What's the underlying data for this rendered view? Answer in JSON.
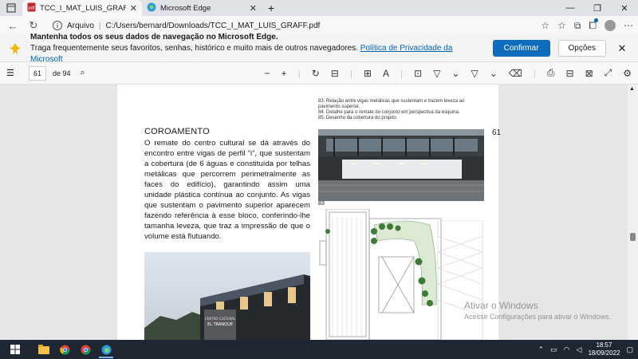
{
  "tabs": [
    {
      "title": "TCC_I_MAT_LUIS_GRAFF.pdf",
      "icon": "pdf-icon",
      "active": true
    },
    {
      "title": "Microsoft Edge",
      "icon": "edge-icon",
      "active": false
    }
  ],
  "window": {
    "minimize": "—",
    "maximize": "❐",
    "close": "✕"
  },
  "address": {
    "protocol_label": "Arquivo",
    "url": "C:/Users/bernard/Downloads/TCC_I_MAT_LUIS_GRAFF.pdf"
  },
  "notification": {
    "line1": "Mantenha todos os seus dados de navegação no Microsoft Edge.",
    "line2": "Traga frequentemente seus favoritos, senhas, histórico e muito mais de outros navegadores.",
    "link": "Política de Privacidade da Microsoft",
    "confirm": "Confirmar",
    "options": "Opções"
  },
  "pdf_toolbar": {
    "page": "61",
    "of_label": "de 94"
  },
  "page": {
    "captions": [
      "83. Relação entre vigas metálicas que sustentam e trazem leveza ao",
      "pavimento superior.",
      "84. Detalhe para o remate do conjunto em perspectiva da esquina.",
      "85. Desenho da cobertura do projeto."
    ],
    "heading": "COROAMENTO",
    "page_number": "61",
    "body": "O remate do centro cultural se dá através do encontro entre vigas de perfil “i”, que sustentam a cobertura (de 6 águas e constituída por telhas metálicas que percorrem perimetralmente as faces do edifício), garantindo assim uma unidade plástica contínua ao conjunto. As vigas que sustentam o pavimento superior aparecem fazendo referência à esse bloco, conferindo-lhe tamanha leveza, que traz a impressão de que o volume está flutuando.",
    "figure_number": "83"
  },
  "watermark": {
    "line1": "Ativar o Windows",
    "line2": "Acesse Configurações para ativar o Windows."
  },
  "taskbar": {
    "time": "18:57",
    "date": "18/09/2022"
  }
}
